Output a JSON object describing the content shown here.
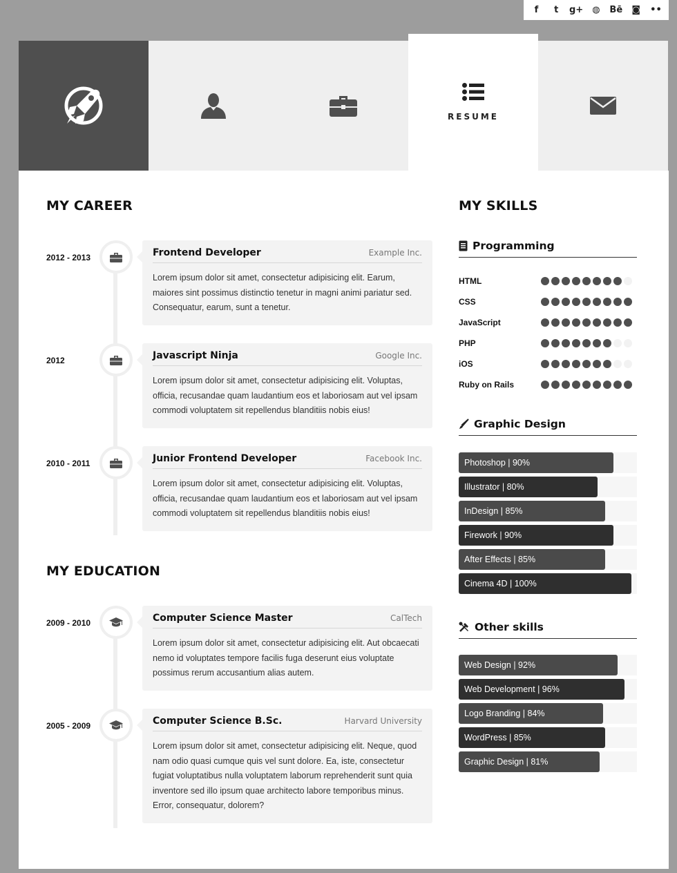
{
  "social": [
    {
      "name": "facebook",
      "glyph": "f"
    },
    {
      "name": "twitter",
      "glyph": "t"
    },
    {
      "name": "google-plus",
      "glyph": "g+"
    },
    {
      "name": "dribbble",
      "glyph": "◍"
    },
    {
      "name": "behance",
      "glyph": "Bē"
    },
    {
      "name": "instagram",
      "glyph": "◙"
    },
    {
      "name": "flickr",
      "glyph": "••"
    }
  ],
  "nav": {
    "active_label": "RESUME"
  },
  "career": {
    "title": "MY CAREER",
    "items": [
      {
        "date": "2012 - 2013",
        "role": "Frontend Developer",
        "company": "Example Inc.",
        "desc": "Lorem ipsum dolor sit amet, consectetur adipisicing elit. Earum, maiores sint possimus distinctio tenetur in magni animi pariatur sed. Consequatur, earum, sunt a tenetur."
      },
      {
        "date": "2012",
        "role": "Javascript Ninja",
        "company": "Google Inc.",
        "desc": "Lorem ipsum dolor sit amet, consectetur adipisicing elit. Voluptas, officia, recusandae quam laudantium eos et laboriosam aut vel ipsam commodi voluptatem sit repellendus blanditiis nobis eius!"
      },
      {
        "date": "2010 - 2011",
        "role": "Junior Frontend Developer",
        "company": "Facebook Inc.",
        "desc": "Lorem ipsum dolor sit amet, consectetur adipisicing elit. Voluptas, officia, recusandae quam laudantium eos et laboriosam aut vel ipsam commodi voluptatem sit repellendus blanditiis nobis eius!"
      }
    ]
  },
  "education": {
    "title": "MY EDUCATION",
    "items": [
      {
        "date": "2009 - 2010",
        "role": "Computer Science Master",
        "company": "CalTech",
        "desc": "Lorem ipsum dolor sit amet, consectetur adipisicing elit. Aut obcaecati nemo id voluptates tempore facilis fuga deserunt eius voluptate possimus rerum accusantium alias autem."
      },
      {
        "date": "2005 - 2009",
        "role": "Computer Science B.Sc.",
        "company": "Harvard University",
        "desc": "Lorem ipsum dolor sit amet, consectetur adipisicing elit. Neque, quod nam odio quasi cumque quis vel sunt dolore. Ea, iste, consectetur fugiat voluptatibus nulla voluptatem laborum reprehenderit sunt quia inventore sed illo ipsum quae architecto labore temporibus minus. Error, consequatur, dolorem?"
      }
    ]
  },
  "skills": {
    "title": "MY SKILLS",
    "programming": {
      "title": "Programming",
      "max": 9,
      "items": [
        {
          "name": "HTML",
          "level": 8
        },
        {
          "name": "CSS",
          "level": 9
        },
        {
          "name": "JavaScript",
          "level": 9
        },
        {
          "name": "PHP",
          "level": 7
        },
        {
          "name": "iOS",
          "level": 7
        },
        {
          "name": "Ruby on Rails",
          "level": 9
        }
      ]
    },
    "graphic": {
      "title": "Graphic Design",
      "items": [
        {
          "label": "Photoshop | 90%",
          "percent": 90
        },
        {
          "label": "Illustrator | 80%",
          "percent": 80
        },
        {
          "label": "InDesign | 85%",
          "percent": 85
        },
        {
          "label": "Firework | 90%",
          "percent": 90
        },
        {
          "label": "After Effects | 85%",
          "percent": 85
        },
        {
          "label": "Cinema 4D | 100%",
          "percent": 100
        }
      ]
    },
    "other": {
      "title": "Other skills",
      "items": [
        {
          "label": "Web Design | 92%",
          "percent": 92
        },
        {
          "label": "Web Development | 96%",
          "percent": 96
        },
        {
          "label": "Logo Branding | 84%",
          "percent": 84
        },
        {
          "label": "WordPress | 85%",
          "percent": 85
        },
        {
          "label": "Graphic Design | 81%",
          "percent": 81
        }
      ]
    }
  }
}
